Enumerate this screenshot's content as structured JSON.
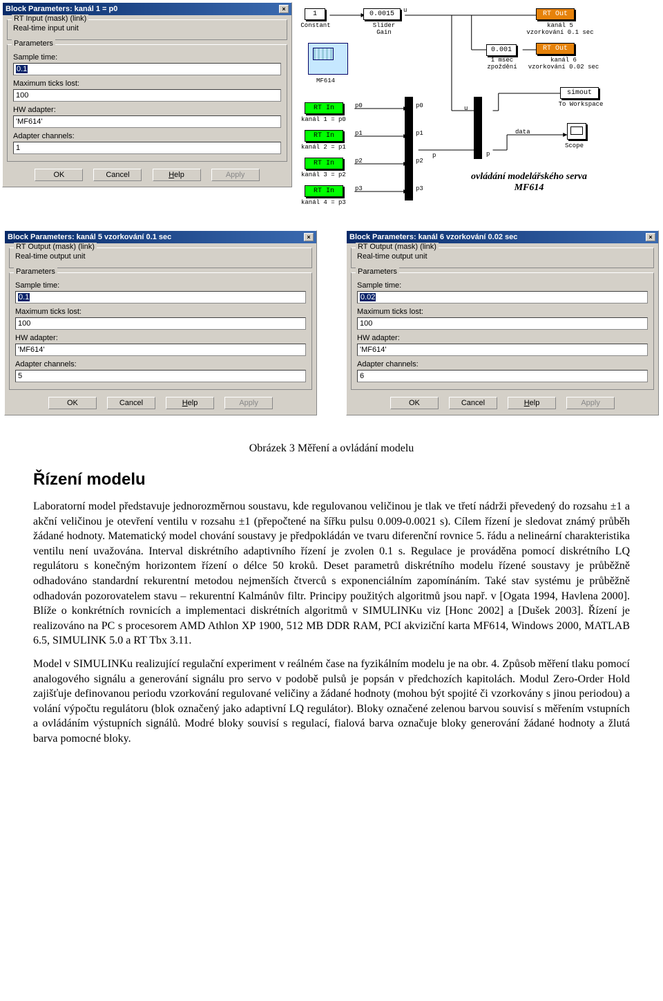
{
  "dialog1": {
    "title": "Block Parameters: kanál 1 = p0",
    "group_rt": "RT Input (mask) (link)",
    "rt_desc": "Real-time input unit",
    "group_params": "Parameters",
    "sample_label": "Sample time:",
    "sample_val": "0.1",
    "max_label": "Maximum ticks lost:",
    "max_val": "100",
    "hw_label": "HW adapter:",
    "hw_val": "'MF614'",
    "chan_label": "Adapter channels:",
    "chan_val": "1",
    "ok": "OK",
    "cancel": "Cancel",
    "help": "Help",
    "apply": "Apply"
  },
  "dialog2": {
    "title": "Block Parameters: kanál 5 vzorkování 0.1 sec",
    "group_rt": "RT Output (mask) (link)",
    "rt_desc": "Real-time output unit",
    "group_params": "Parameters",
    "sample_label": "Sample time:",
    "sample_val": "0.1",
    "max_label": "Maximum ticks lost:",
    "max_val": "100",
    "hw_label": "HW adapter:",
    "hw_val": "'MF614'",
    "chan_label": "Adapter channels:",
    "chan_val": "5",
    "ok": "OK",
    "cancel": "Cancel",
    "help": "Help",
    "apply": "Apply"
  },
  "dialog3": {
    "title": "Block Parameters: kanál 6 vzorkování 0.02 sec",
    "group_rt": "RT Output (mask) (link)",
    "rt_desc": "Real-time output unit",
    "group_params": "Parameters",
    "sample_label": "Sample time:",
    "sample_val": "0.02",
    "max_label": "Maximum ticks lost:",
    "max_val": "100",
    "hw_label": "HW adapter:",
    "hw_val": "'MF614'",
    "chan_label": "Adapter channels:",
    "chan_val": "6",
    "ok": "OK",
    "cancel": "Cancel",
    "help": "Help",
    "apply": "Apply"
  },
  "diagram": {
    "constant_val": "1",
    "constant_lbl": "Constant",
    "slider_val": "0.0015",
    "slider_lbl": "Slider\nGain",
    "slider_port": "u",
    "mf614": "MF614",
    "rt_in": "RT In",
    "rt_out": "RT Out",
    "k1": "kanál 1 = p0",
    "k2": "kanál 2 = p1",
    "k3": "kanál 3 = p2",
    "k4": "kanál 4 = p3",
    "p0": "p0",
    "p1": "p1",
    "p2": "p2",
    "p3": "p3",
    "u": "u",
    "p": "p",
    "data": "data",
    "msec_val": "0.001",
    "msec_lbl": "1 msec\nzpoždění",
    "k5": "kanál 5\nvzorkování 0.1 sec",
    "k6": "kanál 6\nvzorkování 0.02 sec",
    "simout": "simout",
    "towork": "To Workspace",
    "scope": "Scope",
    "title": "ovládání modelářského serva\nMF614"
  },
  "article": {
    "caption": "Obrázek 3 Měření a ovládání modelu",
    "heading": "Řízení modelu",
    "p1": "Laboratorní model představuje jednorozměrnou soustavu, kde regulovanou veličinou je tlak ve třetí nádrži převedený do rozsahu ±1 a akční veličinou je otevření ventilu v rozsahu ±1 (přepočtené na šířku pulsu 0.009-0.0021 s). Cílem řízení je sledovat známý průběh žádané hodnoty. Matematický model chování soustavy je předpokládán ve tvaru diferenční rovnice 5. řádu a nelineární charakteristika ventilu není uvažována. Interval diskrétního adaptivního řízení je zvolen 0.1 s. Regulace je prováděna pomocí diskrétního LQ regulátoru s konečným horizontem řízení o délce 50 kroků. Deset parametrů diskrétního modelu řízené soustavy je průběžně odhadováno standardní rekurentní metodou nejmenších čtverců s exponenciálním zapomínáním. Také stav systému je průběžně odhadován pozorovatelem stavu – rekurentní Kalmánův filtr. Principy použitých algoritmů jsou např. v [Ogata 1994, Havlena 2000]. Blíže o konkrétních rovnicích a implementaci diskrétních algoritmů v SIMULINKu viz [Honc 2002] a [Dušek 2003]. Řízení je realizováno na PC s procesorem AMD Athlon XP 1900, 512 MB DDR RAM, PCI akviziční karta MF614, Windows 2000, MATLAB 6.5, SIMULINK 5.0 a RT Tbx 3.11.",
    "p2": "Model v SIMULINKu realizující regulační experiment v reálném čase na fyzikálním modelu je na obr. 4. Způsob měření tlaku pomocí analogového signálu a generování signálu pro servo v podobě pulsů je popsán v předchozích kapitolách. Modul Zero-Order Hold zajišťuje definovanou periodu vzorkování regulované veličiny a žádané hodnoty (mohou být spojité či vzorkovány s jinou periodou) a volání výpočtu regulátoru (blok označený jako adaptivní LQ regulátor). Bloky označené zelenou barvou souvisí s měřením vstupních a ovládáním výstupních signálů. Modré bloky souvisí s regulací, fialová barva označuje bloky generování žádané hodnoty a žlutá barva pomocné bloky."
  }
}
